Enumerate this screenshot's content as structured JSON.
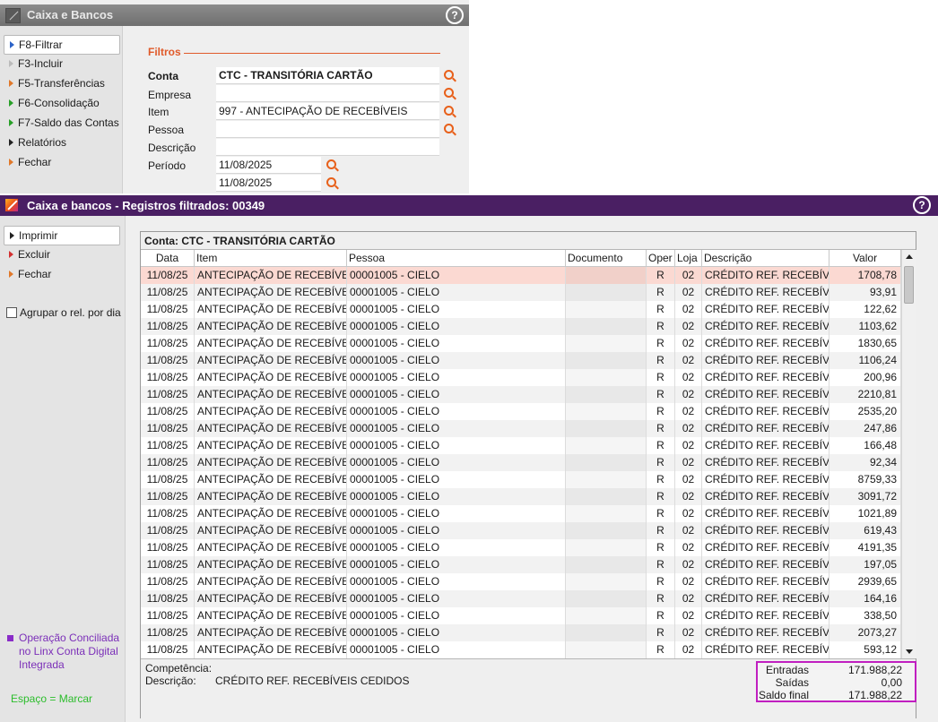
{
  "top_window": {
    "title": "Caixa e Bancos",
    "menu": [
      {
        "label": "F8-Filtrar",
        "arrow": "blue"
      },
      {
        "label": "F3-Incluir",
        "arrow": "grey"
      },
      {
        "label": "F5-Transferências",
        "arrow": "orange"
      },
      {
        "label": "F6-Consolidação",
        "arrow": "green"
      },
      {
        "label": "F7-Saldo das Contas",
        "arrow": "green"
      },
      {
        "label": "Relatórios",
        "arrow": "black"
      },
      {
        "label": "Fechar",
        "arrow": "orange"
      }
    ],
    "filters": {
      "heading": "Filtros",
      "conta_label": "Conta",
      "conta_value": "CTC - TRANSITÓRIA CARTÃO",
      "empresa_label": "Empresa",
      "empresa_value": "",
      "item_label": "Item",
      "item_value": "997 - ANTECIPAÇÃO DE RECEBÍVEIS",
      "pessoa_label": "Pessoa",
      "pessoa_value": "",
      "descricao_label": "Descrição",
      "descricao_value": "",
      "periodo_label": "Período",
      "periodo_inicio": "11/08/2025",
      "periodo_fim": "11/08/2025"
    }
  },
  "main_window": {
    "title": "Caixa e bancos - Registros filtrados: 00349",
    "menu": [
      {
        "label": "Imprimir",
        "arrow": "black"
      },
      {
        "label": "Excluir",
        "arrow": "red"
      },
      {
        "label": "Fechar",
        "arrow": "orange"
      }
    ],
    "agrupar_label": "Agrupar o rel. por dia",
    "operacao_note": "Operação Conciliada no Linx Conta Digital Integrada",
    "espaco_note": "Espaço = Marcar",
    "grid": {
      "caption": "Conta: CTC - TRANSITÓRIA CARTÃO",
      "columns": [
        "Data",
        "Item",
        "Pessoa",
        "Documento",
        "Oper",
        "Loja",
        "Descrição",
        "Valor"
      ],
      "rows": [
        {
          "data": "11/08/25",
          "item": "ANTECIPAÇÃO DE RECEBÍVEIS",
          "pessoa": "00001005 - CIELO",
          "documento": "",
          "oper": "R",
          "loja": "02",
          "descricao": "CRÉDITO REF. RECEBÍVEIS",
          "valor": "1708,78"
        },
        {
          "data": "11/08/25",
          "item": "ANTECIPAÇÃO DE RECEBÍVEIS",
          "pessoa": "00001005 - CIELO",
          "documento": "",
          "oper": "R",
          "loja": "02",
          "descricao": "CRÉDITO REF. RECEBÍVEIS",
          "valor": "93,91"
        },
        {
          "data": "11/08/25",
          "item": "ANTECIPAÇÃO DE RECEBÍVEIS",
          "pessoa": "00001005 - CIELO",
          "documento": "",
          "oper": "R",
          "loja": "02",
          "descricao": "CRÉDITO REF. RECEBÍVEIS",
          "valor": "122,62"
        },
        {
          "data": "11/08/25",
          "item": "ANTECIPAÇÃO DE RECEBÍVEIS",
          "pessoa": "00001005 - CIELO",
          "documento": "",
          "oper": "R",
          "loja": "02",
          "descricao": "CRÉDITO REF. RECEBÍVEIS",
          "valor": "1103,62"
        },
        {
          "data": "11/08/25",
          "item": "ANTECIPAÇÃO DE RECEBÍVEIS",
          "pessoa": "00001005 - CIELO",
          "documento": "",
          "oper": "R",
          "loja": "02",
          "descricao": "CRÉDITO REF. RECEBÍVEIS",
          "valor": "1830,65"
        },
        {
          "data": "11/08/25",
          "item": "ANTECIPAÇÃO DE RECEBÍVEIS",
          "pessoa": "00001005 - CIELO",
          "documento": "",
          "oper": "R",
          "loja": "02",
          "descricao": "CRÉDITO REF. RECEBÍVEIS",
          "valor": "1106,24"
        },
        {
          "data": "11/08/25",
          "item": "ANTECIPAÇÃO DE RECEBÍVEIS",
          "pessoa": "00001005 - CIELO",
          "documento": "",
          "oper": "R",
          "loja": "02",
          "descricao": "CRÉDITO REF. RECEBÍVEIS",
          "valor": "200,96"
        },
        {
          "data": "11/08/25",
          "item": "ANTECIPAÇÃO DE RECEBÍVEIS",
          "pessoa": "00001005 - CIELO",
          "documento": "",
          "oper": "R",
          "loja": "02",
          "descricao": "CRÉDITO REF. RECEBÍVEIS",
          "valor": "2210,81"
        },
        {
          "data": "11/08/25",
          "item": "ANTECIPAÇÃO DE RECEBÍVEIS",
          "pessoa": "00001005 - CIELO",
          "documento": "",
          "oper": "R",
          "loja": "02",
          "descricao": "CRÉDITO REF. RECEBÍVEIS",
          "valor": "2535,20"
        },
        {
          "data": "11/08/25",
          "item": "ANTECIPAÇÃO DE RECEBÍVEIS",
          "pessoa": "00001005 - CIELO",
          "documento": "",
          "oper": "R",
          "loja": "02",
          "descricao": "CRÉDITO REF. RECEBÍVEIS",
          "valor": "247,86"
        },
        {
          "data": "11/08/25",
          "item": "ANTECIPAÇÃO DE RECEBÍVEIS",
          "pessoa": "00001005 - CIELO",
          "documento": "",
          "oper": "R",
          "loja": "02",
          "descricao": "CRÉDITO REF. RECEBÍVEIS",
          "valor": "166,48"
        },
        {
          "data": "11/08/25",
          "item": "ANTECIPAÇÃO DE RECEBÍVEIS",
          "pessoa": "00001005 - CIELO",
          "documento": "",
          "oper": "R",
          "loja": "02",
          "descricao": "CRÉDITO REF. RECEBÍVEIS",
          "valor": "92,34"
        },
        {
          "data": "11/08/25",
          "item": "ANTECIPAÇÃO DE RECEBÍVEIS",
          "pessoa": "00001005 - CIELO",
          "documento": "",
          "oper": "R",
          "loja": "02",
          "descricao": "CRÉDITO REF. RECEBÍVEIS",
          "valor": "8759,33"
        },
        {
          "data": "11/08/25",
          "item": "ANTECIPAÇÃO DE RECEBÍVEIS",
          "pessoa": "00001005 - CIELO",
          "documento": "",
          "oper": "R",
          "loja": "02",
          "descricao": "CRÉDITO REF. RECEBÍVEIS",
          "valor": "3091,72"
        },
        {
          "data": "11/08/25",
          "item": "ANTECIPAÇÃO DE RECEBÍVEIS",
          "pessoa": "00001005 - CIELO",
          "documento": "",
          "oper": "R",
          "loja": "02",
          "descricao": "CRÉDITO REF. RECEBÍVEIS",
          "valor": "1021,89"
        },
        {
          "data": "11/08/25",
          "item": "ANTECIPAÇÃO DE RECEBÍVEIS",
          "pessoa": "00001005 - CIELO",
          "documento": "",
          "oper": "R",
          "loja": "02",
          "descricao": "CRÉDITO REF. RECEBÍVEIS",
          "valor": "619,43"
        },
        {
          "data": "11/08/25",
          "item": "ANTECIPAÇÃO DE RECEBÍVEIS",
          "pessoa": "00001005 - CIELO",
          "documento": "",
          "oper": "R",
          "loja": "02",
          "descricao": "CRÉDITO REF. RECEBÍVEIS",
          "valor": "4191,35"
        },
        {
          "data": "11/08/25",
          "item": "ANTECIPAÇÃO DE RECEBÍVEIS",
          "pessoa": "00001005 - CIELO",
          "documento": "",
          "oper": "R",
          "loja": "02",
          "descricao": "CRÉDITO REF. RECEBÍVEIS",
          "valor": "197,05"
        },
        {
          "data": "11/08/25",
          "item": "ANTECIPAÇÃO DE RECEBÍVEIS",
          "pessoa": "00001005 - CIELO",
          "documento": "",
          "oper": "R",
          "loja": "02",
          "descricao": "CRÉDITO REF. RECEBÍVEIS",
          "valor": "2939,65"
        },
        {
          "data": "11/08/25",
          "item": "ANTECIPAÇÃO DE RECEBÍVEIS",
          "pessoa": "00001005 - CIELO",
          "documento": "",
          "oper": "R",
          "loja": "02",
          "descricao": "CRÉDITO REF. RECEBÍVEIS",
          "valor": "164,16"
        },
        {
          "data": "11/08/25",
          "item": "ANTECIPAÇÃO DE RECEBÍVEIS",
          "pessoa": "00001005 - CIELO",
          "documento": "",
          "oper": "R",
          "loja": "02",
          "descricao": "CRÉDITO REF. RECEBÍVEIS",
          "valor": "338,50"
        },
        {
          "data": "11/08/25",
          "item": "ANTECIPAÇÃO DE RECEBÍVEIS",
          "pessoa": "00001005 - CIELO",
          "documento": "",
          "oper": "R",
          "loja": "02",
          "descricao": "CRÉDITO REF. RECEBÍVEIS",
          "valor": "2073,27"
        },
        {
          "data": "11/08/25",
          "item": "ANTECIPAÇÃO DE RECEBÍVEIS",
          "pessoa": "00001005 - CIELO",
          "documento": "",
          "oper": "R",
          "loja": "02",
          "descricao": "CRÉDITO REF. RECEBÍVEIS",
          "valor": "593,12"
        }
      ]
    },
    "footer": {
      "competencia_label": "Competência:",
      "competencia_value": "",
      "descricao_label": "Descrição:",
      "descricao_value": "CRÉDITO REF. RECEBÍVEIS CEDIDOS",
      "entradas_label": "Entradas",
      "entradas_value": "171.988,22",
      "saidas_label": "Saídas",
      "saidas_value": "0,00",
      "saldo_label": "Saldo final",
      "saldo_value": "171.988,22"
    }
  }
}
